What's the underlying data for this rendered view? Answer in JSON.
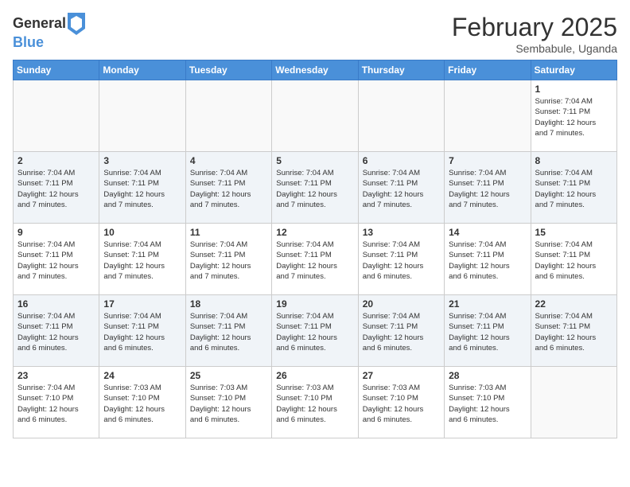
{
  "header": {
    "logo_general": "General",
    "logo_blue": "Blue",
    "month_title": "February 2025",
    "location": "Sembabule, Uganda"
  },
  "days_of_week": [
    "Sunday",
    "Monday",
    "Tuesday",
    "Wednesday",
    "Thursday",
    "Friday",
    "Saturday"
  ],
  "weeks": [
    [
      {
        "day": "",
        "info": ""
      },
      {
        "day": "",
        "info": ""
      },
      {
        "day": "",
        "info": ""
      },
      {
        "day": "",
        "info": ""
      },
      {
        "day": "",
        "info": ""
      },
      {
        "day": "",
        "info": ""
      },
      {
        "day": "1",
        "info": "Sunrise: 7:04 AM\nSunset: 7:11 PM\nDaylight: 12 hours\nand 7 minutes."
      }
    ],
    [
      {
        "day": "2",
        "info": "Sunrise: 7:04 AM\nSunset: 7:11 PM\nDaylight: 12 hours\nand 7 minutes."
      },
      {
        "day": "3",
        "info": "Sunrise: 7:04 AM\nSunset: 7:11 PM\nDaylight: 12 hours\nand 7 minutes."
      },
      {
        "day": "4",
        "info": "Sunrise: 7:04 AM\nSunset: 7:11 PM\nDaylight: 12 hours\nand 7 minutes."
      },
      {
        "day": "5",
        "info": "Sunrise: 7:04 AM\nSunset: 7:11 PM\nDaylight: 12 hours\nand 7 minutes."
      },
      {
        "day": "6",
        "info": "Sunrise: 7:04 AM\nSunset: 7:11 PM\nDaylight: 12 hours\nand 7 minutes."
      },
      {
        "day": "7",
        "info": "Sunrise: 7:04 AM\nSunset: 7:11 PM\nDaylight: 12 hours\nand 7 minutes."
      },
      {
        "day": "8",
        "info": "Sunrise: 7:04 AM\nSunset: 7:11 PM\nDaylight: 12 hours\nand 7 minutes."
      }
    ],
    [
      {
        "day": "9",
        "info": "Sunrise: 7:04 AM\nSunset: 7:11 PM\nDaylight: 12 hours\nand 7 minutes."
      },
      {
        "day": "10",
        "info": "Sunrise: 7:04 AM\nSunset: 7:11 PM\nDaylight: 12 hours\nand 7 minutes."
      },
      {
        "day": "11",
        "info": "Sunrise: 7:04 AM\nSunset: 7:11 PM\nDaylight: 12 hours\nand 7 minutes."
      },
      {
        "day": "12",
        "info": "Sunrise: 7:04 AM\nSunset: 7:11 PM\nDaylight: 12 hours\nand 7 minutes."
      },
      {
        "day": "13",
        "info": "Sunrise: 7:04 AM\nSunset: 7:11 PM\nDaylight: 12 hours\nand 6 minutes."
      },
      {
        "day": "14",
        "info": "Sunrise: 7:04 AM\nSunset: 7:11 PM\nDaylight: 12 hours\nand 6 minutes."
      },
      {
        "day": "15",
        "info": "Sunrise: 7:04 AM\nSunset: 7:11 PM\nDaylight: 12 hours\nand 6 minutes."
      }
    ],
    [
      {
        "day": "16",
        "info": "Sunrise: 7:04 AM\nSunset: 7:11 PM\nDaylight: 12 hours\nand 6 minutes."
      },
      {
        "day": "17",
        "info": "Sunrise: 7:04 AM\nSunset: 7:11 PM\nDaylight: 12 hours\nand 6 minutes."
      },
      {
        "day": "18",
        "info": "Sunrise: 7:04 AM\nSunset: 7:11 PM\nDaylight: 12 hours\nand 6 minutes."
      },
      {
        "day": "19",
        "info": "Sunrise: 7:04 AM\nSunset: 7:11 PM\nDaylight: 12 hours\nand 6 minutes."
      },
      {
        "day": "20",
        "info": "Sunrise: 7:04 AM\nSunset: 7:11 PM\nDaylight: 12 hours\nand 6 minutes."
      },
      {
        "day": "21",
        "info": "Sunrise: 7:04 AM\nSunset: 7:11 PM\nDaylight: 12 hours\nand 6 minutes."
      },
      {
        "day": "22",
        "info": "Sunrise: 7:04 AM\nSunset: 7:11 PM\nDaylight: 12 hours\nand 6 minutes."
      }
    ],
    [
      {
        "day": "23",
        "info": "Sunrise: 7:04 AM\nSunset: 7:10 PM\nDaylight: 12 hours\nand 6 minutes."
      },
      {
        "day": "24",
        "info": "Sunrise: 7:03 AM\nSunset: 7:10 PM\nDaylight: 12 hours\nand 6 minutes."
      },
      {
        "day": "25",
        "info": "Sunrise: 7:03 AM\nSunset: 7:10 PM\nDaylight: 12 hours\nand 6 minutes."
      },
      {
        "day": "26",
        "info": "Sunrise: 7:03 AM\nSunset: 7:10 PM\nDaylight: 12 hours\nand 6 minutes."
      },
      {
        "day": "27",
        "info": "Sunrise: 7:03 AM\nSunset: 7:10 PM\nDaylight: 12 hours\nand 6 minutes."
      },
      {
        "day": "28",
        "info": "Sunrise: 7:03 AM\nSunset: 7:10 PM\nDaylight: 12 hours\nand 6 minutes."
      },
      {
        "day": "",
        "info": ""
      }
    ]
  ]
}
